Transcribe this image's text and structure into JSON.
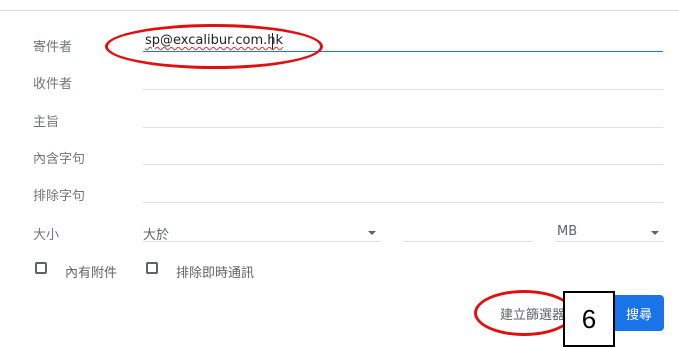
{
  "form": {
    "from_label": "寄件者",
    "from_value": "sp@excalibur.com.hk",
    "to_label": "收件者",
    "subject_label": "主旨",
    "has_words_label": "內含字句",
    "doesnt_have_label": "排除字句",
    "size_label": "大小",
    "size_operator": "大於",
    "size_unit": "MB",
    "has_attachment_label": "內有附件",
    "exclude_chats_label": "排除即時通訊",
    "create_filter_label": "建立篩選器",
    "search_label": "搜尋"
  },
  "annotations": {
    "step_number": "6",
    "highlight_color": "#e01010"
  },
  "colors": {
    "accent": "#1a73e8"
  }
}
